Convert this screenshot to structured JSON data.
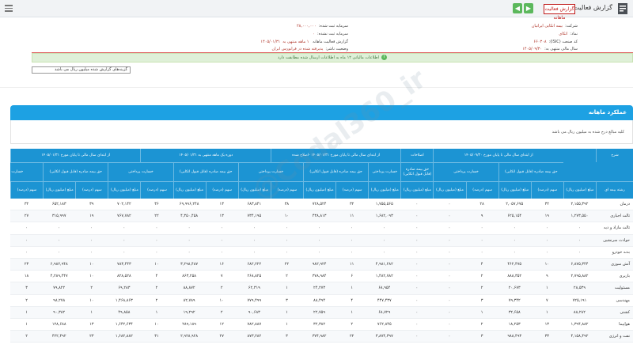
{
  "header": {
    "title": "گزارش فعالیت ماهانه",
    "red_button_label": "گزارش فعالیت ماهانه"
  },
  "info": {
    "company_label": "شرکت:",
    "company_value": "بیمه اتکایی ایرانیان",
    "symbol_label": "نماد:",
    "symbol_value": "اتکای",
    "code_label": "کد صنعت (ISIC):",
    "code_value": "۶۶۰۳۰۸",
    "report_label": "گزارش فعالیت ماهانه",
    "period_label": "۱ ماهه منتهی به",
    "period_value": "۱۴۰۵/۰۱/۳۱",
    "year_label": "سال مالی منتهی به:",
    "year_value": "۱۴۰۵/۰۹/۳۰",
    "capital_label": "سرمایه ثبت شده:",
    "capital_value": "۲۸,۰۰۰,۰۰۰",
    "unreg_label": "سرمایه ثبت نشده:",
    "unreg_value": "۰",
    "status_label": "وضعیت ناشر:",
    "status_value": "پذیرفته شده در فرابورس ایران"
  },
  "notice": "اطلاعات مالیاتی ۱۲ ماه به اطلاعات ارسال شده مطابقت دارد",
  "select_value": "گزینه‌های گزارش شده میلیون ریال می باشد",
  "section_title": "عملکرد ماهانه",
  "subnote": "کلیه مبالغ درج شده به میلیون ریال می باشد",
  "table": {
    "h1": [
      "شرح",
      "از ابتدای سال مالی تا پایان مورخ ۱۴۰۵/۰۹/۳۰",
      "اصلاحات",
      "از ابتدای سال مالی تا پایان مورخ ۱۴۰۵/۰۱/۳۱ -اصلاح شده",
      "دوره یک ماهه منتهی به ۱۴۰۵/۰۱/۳۱",
      "از ابتدای سال مالی تا پایان مورخ ۱۴۰۵/۰۱/۳۱"
    ],
    "h2": [
      "حق بیمه صادره (قابل قبول اتکایی)",
      "خسارت پرداختی",
      "حق بیمه صادره (قابل قبول اتکایی)",
      "خسارت پرداختی",
      "حق بیمه صادره (قابل قبول اتکایی)",
      "خسارت پرداختی",
      "حق بیمه صادره (قابل قبول اتکایی)",
      "خسارت پرداختی",
      "حق بیمه صادره (قابل قبول اتکایی)",
      "خسارت پرداختی"
    ],
    "h3": [
      "رشته بیمه ای",
      "مبلغ (میلیون ریال)",
      "سهم (درصد)",
      "مبلغ (میلیون ریال)",
      "سهم (درصد)",
      "مبلغ (میلیون ریال)",
      "مبلغ (میلیون ریال)",
      "مبلغ (میلیون ریال)",
      "سهم (درصد)",
      "مبلغ (میلیون ریال)",
      "سهم (درصد)",
      "مبلغ (میلیون ریال)",
      "سهم (درصد)",
      "مبلغ (میلیون ریال)",
      "سهم (درصد)",
      "مبلغ (میلیون ریال)",
      "سهم (درصد)",
      "مبلغ (میلیون ریال)",
      "سهم (درصد)"
    ],
    "rows": [
      [
        "درمان",
        "۲,۱۵۵,۳۹۲",
        "۳۲",
        "۲,۰۵۷,۶۷۵",
        "۲۸",
        "۰",
        "۰",
        "۱,۷۵۵,۵۶۵",
        "۳۲",
        "۷۲۸,۵۲۴",
        "۳۸",
        "۶۸۳,۸۴۱",
        "۱۳",
        "۶۹,۹۹۶,۲۴۸",
        "۳۶",
        "۷۰۲,۱۴۲",
        "۳۹",
        "۶۵۲,۱۸۳",
        "۳۲"
      ],
      [
        "ثالث اجباری",
        "۱,۲۷۳,۵۵۰",
        "۱۹",
        "۶۲۵,۱۵۴",
        "۹",
        "۰",
        "۰",
        "۱,۶۸۲,۰۹۳",
        "۱۱",
        "۴۳۸,۸۱۳",
        "۱۰",
        "۷۳۴,۱۹۵",
        "۱۳",
        "۴,۳۵۰,۴۵۸",
        "۲۲",
        "۷۶۷,۷۸۲",
        "۱۹",
        "۳۱۵,۹۹۷",
        "۲۷"
      ],
      [
        "ثالث مازاد و دیه",
        "۰",
        "۰",
        "۰",
        "۰",
        "۰",
        "۰",
        "۰",
        "۰",
        "۰",
        "۰",
        "۰",
        "۰",
        "۰",
        "۰",
        "۰",
        "۰",
        "۰",
        "۰"
      ],
      [
        "حوادث سرنشین",
        "۰",
        "۰",
        "۰",
        "۰",
        "۰",
        "۰",
        "۰",
        "۰",
        "۰",
        "۰",
        "۰",
        "۰",
        "۰",
        "۰",
        "۰",
        "۰",
        "۰",
        "۰"
      ],
      [
        "بدنه خودرو",
        "۰",
        "۰",
        "۰",
        "۰",
        "۰",
        "۰",
        "۰",
        "۰",
        "۰",
        "۰",
        "۰",
        "۰",
        "۰",
        "۰",
        "۰",
        "۰",
        "۰",
        "۰"
      ],
      [
        "آتش سوزی",
        "۶,۸۷۵,۳۴۴",
        "۱۰",
        "۴۶۲,۴۷۵",
        "۴",
        "۰",
        "۰",
        "۴,۹۸۱,۲۸۲",
        "۱۱",
        "۹۸۲,۹۲۴",
        "۲۲",
        "۶۸۲,۲۲۲",
        "۱۶",
        "۳,۲۹۸,۴۸۷",
        "۱۰",
        "۷۸۳,۴۴۳",
        "۱۰",
        "۶,۹۸۲,۹۴۸",
        "۲۳"
      ],
      [
        "باربری",
        "۲,۷۹۵,۸۸۲",
        "۹",
        "۸۸۸,۳۵۲",
        "۲",
        "۰",
        "۰",
        "۱,۴۸۲,۷۸۲",
        "۶",
        "۳۷۸,۹۸۴",
        "۲",
        "۲۶۸,۸۲۵",
        "۷",
        "۸۶۳,۲۵۸",
        "۴",
        "۸۲۸,۵۲۸",
        "۱۰",
        "۴,۲۸۹,۴۴۷",
        "۱۸"
      ],
      [
        "مسئولیت",
        "۲۸,۵۳۹",
        "۱",
        "۲۰,۶۷۳",
        "۲",
        "۰",
        "۰",
        "۶۸,۹۵۴",
        "۱",
        "۲۴,۲۷۳",
        "۱",
        "۶۲,۳۱۹",
        "۲",
        "۸۸,۸۷۲",
        "۲",
        "۶۹,۲۸۳",
        "۲",
        "۷۹,۸۲۲",
        "۳"
      ],
      [
        "مهندسی",
        "۷۲۵,۱۹۱",
        "۷",
        "۷۹,۳۴۲",
        "۳",
        "۰",
        "۰",
        "۴۴۷,۴۳۷",
        "۴",
        "۸۸,۴۹۴",
        "۳",
        "۷۷۹,۴۹۹",
        "۱۰",
        "۸۲,۷۸۹",
        "۲",
        "۱,۴۶۸,۸۶۳",
        "۱۰",
        "۹۸,۲۷۸",
        "۲"
      ],
      [
        "کشتی",
        "۸۸,۲۸۲",
        "۱",
        "۳۲,۶۵۸",
        "۱",
        "۰",
        "۰",
        "۶۸,۷۲۹",
        "۱",
        "۲۲,۷۵۹",
        "۱",
        "۹۰,۶۸۳",
        "۲",
        "۱۹,۲۹۲",
        "۱",
        "۴۹,۸۵۸",
        "۱",
        "۹۰,۳۸۲",
        "۱"
      ],
      [
        "هواپیما",
        "۱,۳۹۴,۸۸۲",
        "۱۳",
        "۱۸,۲۵۳",
        "۲",
        "۰",
        "۰",
        "۷۶۲,۸۴۵",
        "۲",
        "۳۲,۳۸۲",
        "۱",
        "۷۸۲,۸۸۷",
        "۱۲",
        "۲۸۹,۱۸۹",
        "۱۰",
        "۱,۶۴۲,۶۳۴",
        "۱۳",
        "۱۲۸,۶۸۸",
        "۱"
      ],
      [
        "نفت و انرژی",
        "۴,۱۵۸,۴۹۲",
        "۳۳",
        "۹۸۸,۴۹۳",
        "۳",
        "۰",
        "۰",
        "۳,۸۷۴,۳۹۷",
        "۲۲",
        "۳۷۴,۹۸۲",
        "۳",
        "۸۷۳,۲۸۲",
        "۲۷",
        "۲,۹۲۸,۹۲۸",
        "۳۱",
        "۱,۶۸۲,۸۸۲",
        "۲۳",
        "۴۲۲,۴۹۲",
        "۲"
      ]
    ]
  }
}
